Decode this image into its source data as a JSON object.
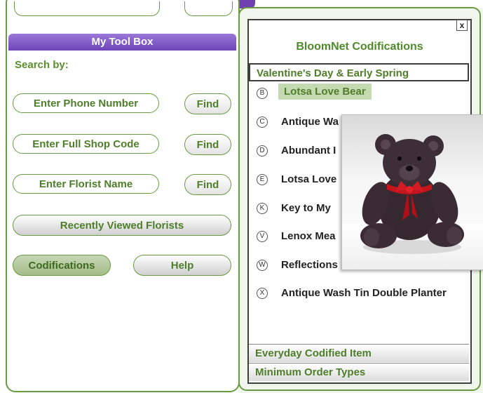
{
  "toolbox": {
    "title": "My Tool Box",
    "search_by": "Search by:",
    "phone_input": "Enter Phone Number",
    "shop_code_input": "Enter Full Shop Code",
    "florist_name_input": "Enter Florist Name",
    "find_label": "Find",
    "recent_button": "Recently Viewed Florists",
    "codifications_button": "Codifications",
    "help_button": "Help"
  },
  "popup": {
    "close": "x",
    "title": "BloomNet Codifications",
    "section_title": "Valentine's Day & Early Spring",
    "items": [
      {
        "letter": "B",
        "label": "Lotsa Love Bear"
      },
      {
        "letter": "C",
        "label": "Antique Wa"
      },
      {
        "letter": "D",
        "label": "Abundant I"
      },
      {
        "letter": "E",
        "label": "Lotsa Love"
      },
      {
        "letter": "K",
        "label": "Key to My"
      },
      {
        "letter": "V",
        "label": "Lenox Mea"
      },
      {
        "letter": "W",
        "label": "Reflections"
      },
      {
        "letter": "X",
        "label": "Antique Wash Tin Double Planter"
      }
    ],
    "footer_sections": [
      "Everyday Codified Item",
      "Minimum Order Types"
    ]
  },
  "colors": {
    "accent_purple": "#6d45b8",
    "accent_green": "#4e7e2a",
    "highlight": "#c6dab2"
  }
}
